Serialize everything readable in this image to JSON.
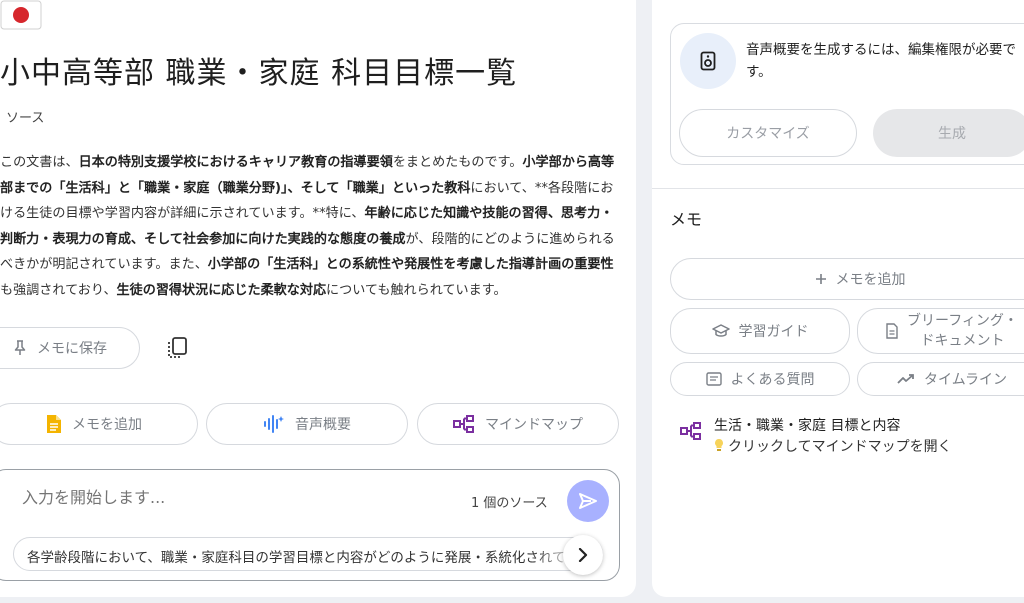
{
  "source": {
    "flag_icon": "japan-flag-icon",
    "title": "小中高等部 職業・家庭 科目目標一覧",
    "source_count": "ソース",
    "summary_segments": [
      {
        "text": "この文書は、",
        "bold": false
      },
      {
        "text": "日本の特別支援学校におけるキャリア教育の指導要領",
        "bold": true
      },
      {
        "text": "をまとめたものです。",
        "bold": false
      },
      {
        "text": "小学部から高等部までの「生活科」と「職業・家庭（職業分野)」、そして「職業」といった教科",
        "bold": true
      },
      {
        "text": "において、**各段階における生徒の目標や学習内容が詳細に示されています。**特に、",
        "bold": false
      },
      {
        "text": "年齢に応じた知識や技能の習得、思考力・判断力・表現力の育成、そして社会参加に向けた実践的な態度の養成",
        "bold": true
      },
      {
        "text": "が、段階的にどのように進められるべきかが明記されています。また、",
        "bold": false
      },
      {
        "text": "小学部の「生活科」との系統性や発展性を考慮した指導計画の重要性",
        "bold": true
      },
      {
        "text": "も強調されており、",
        "bold": false
      },
      {
        "text": "生徒の習得状況に応じた柔軟な対応",
        "bold": true
      },
      {
        "text": "についても触れられています。",
        "bold": false
      }
    ]
  },
  "actions": {
    "save_memo": "メモに保存",
    "add_memo": "メモを追加",
    "audio_overview": "音声概要",
    "mind_map": "マインドマップ"
  },
  "chat": {
    "placeholder": "入力を開始します...",
    "source_count": "1 個のソース",
    "suggestion": "各学齢段階において、職業・家庭科目の学習目標と内容がどのように発展・系統化されているか"
  },
  "studio": {
    "audio_note": "音声概要を生成するには、編集権限が必要です。",
    "customize": "カスタマイズ",
    "generate": "生成",
    "memo_heading": "メモ",
    "add_memo": "メモを追加",
    "study_guide": "学習ガイド",
    "briefing_line1": "ブリーフィング・",
    "briefing_line2": "ドキュメント",
    "faq": "よくある質問",
    "timeline": "タイムライン",
    "mindmap_title": "生活・職業・家庭 目標と内容",
    "mindmap_hint": "クリックしてマインドマップを開く"
  },
  "colors": {
    "mindmap_icon": "#7b2fa0",
    "audio_icon": "#4285f4",
    "memo_icon": "#f4b400",
    "send_button": "#a8b1ff"
  }
}
